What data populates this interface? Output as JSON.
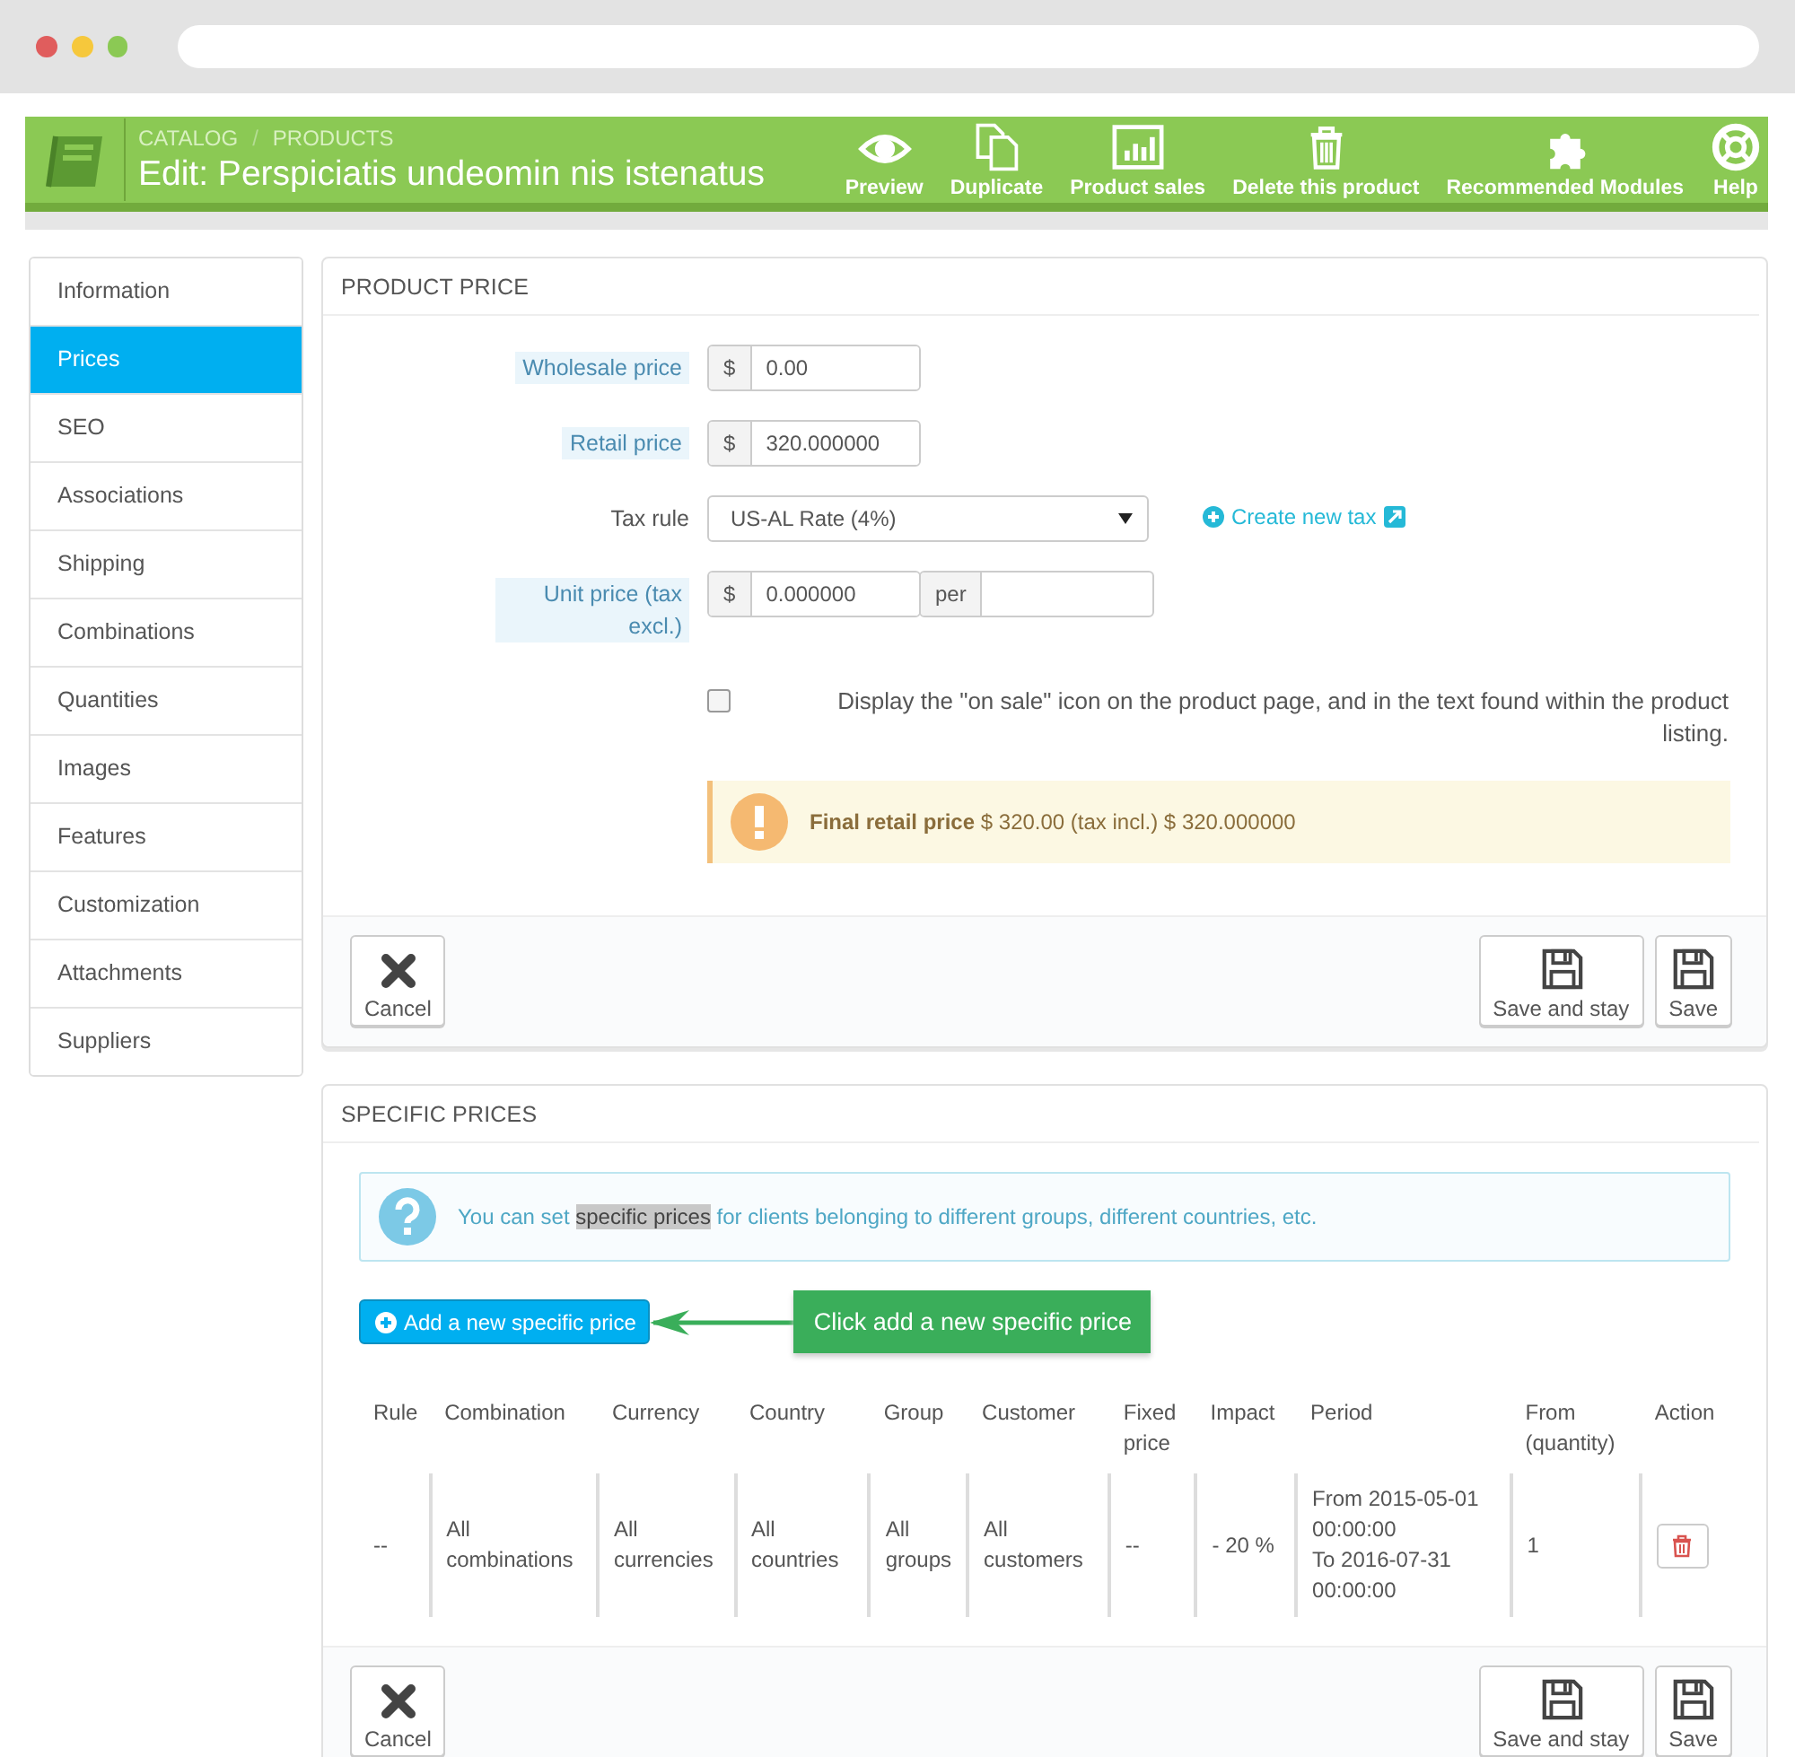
{
  "header": {
    "breadcrumb": [
      "CATALOG",
      "PRODUCTS"
    ],
    "separator": "/",
    "title": "Edit: Perspiciatis undeomin nis istenatus",
    "toolbar": [
      {
        "label": "Preview"
      },
      {
        "label": "Duplicate"
      },
      {
        "label": "Product sales"
      },
      {
        "label": "Delete this product"
      },
      {
        "label": "Recommended Modules"
      },
      {
        "label": "Help"
      }
    ]
  },
  "sidebar": {
    "items": [
      {
        "label": "Information",
        "selected": false
      },
      {
        "label": "Prices",
        "selected": true
      },
      {
        "label": "SEO",
        "selected": false
      },
      {
        "label": "Associations",
        "selected": false
      },
      {
        "label": "Shipping",
        "selected": false
      },
      {
        "label": "Combinations",
        "selected": false
      },
      {
        "label": "Quantities",
        "selected": false
      },
      {
        "label": "Images",
        "selected": false
      },
      {
        "label": "Features",
        "selected": false
      },
      {
        "label": "Customization",
        "selected": false
      },
      {
        "label": "Attachments",
        "selected": false
      },
      {
        "label": "Suppliers",
        "selected": false
      }
    ]
  },
  "product_price": {
    "title": "PRODUCT PRICE",
    "fields": [
      {
        "kind": "money",
        "label": "Wholesale price",
        "hinted": true,
        "prefix": "$",
        "value": "0.00"
      },
      {
        "kind": "money",
        "label": "Retail price",
        "hinted": true,
        "prefix": "$",
        "value": "320.000000"
      },
      {
        "kind": "select",
        "label": "Tax rule",
        "hinted": false,
        "value": "US-AL Rate (4%)",
        "link": "Create new tax"
      },
      {
        "kind": "unit",
        "label": "Unit price (tax excl.)",
        "hinted": true,
        "prefix": "$",
        "value": "0.000000",
        "per": "per"
      }
    ],
    "on_sale": {
      "label": "Display the \"on sale\" icon on the product page, and in the text found within the product listing.",
      "checked": false
    },
    "final_price": "**Final retail price** $ 320.00 (tax incl.) $ 320.000000",
    "buttons": [
      "Cancel",
      "Save and stay",
      "Save"
    ]
  },
  "specific_prices": {
    "title": "SPECIFIC PRICES",
    "info": {
      "before": "You can set ",
      "highlight": "specific prices",
      "after": " for clients belonging to different groups, different countries, etc."
    },
    "add_button": "Add a new specific price",
    "callout": "Click add a new specific price",
    "table": {
      "columns": [
        "Rule",
        "Combination",
        "Currency",
        "Country",
        "Group",
        "Customer",
        "Fixed price",
        "Impact",
        "Period",
        "From (quantity)",
        "Action"
      ],
      "rows": [
        {
          "cells": [
            "--",
            "All combinations",
            "All currencies",
            "All countries",
            "All groups",
            "All customers",
            "--",
            "- 20 %",
            [
              "From 2015-05-01 00:00:00",
              "To 2016-07-31 00:00:00"
            ],
            "1"
          ]
        }
      ]
    },
    "buttons": [
      "Cancel",
      "Save and stay",
      "Save"
    ]
  }
}
